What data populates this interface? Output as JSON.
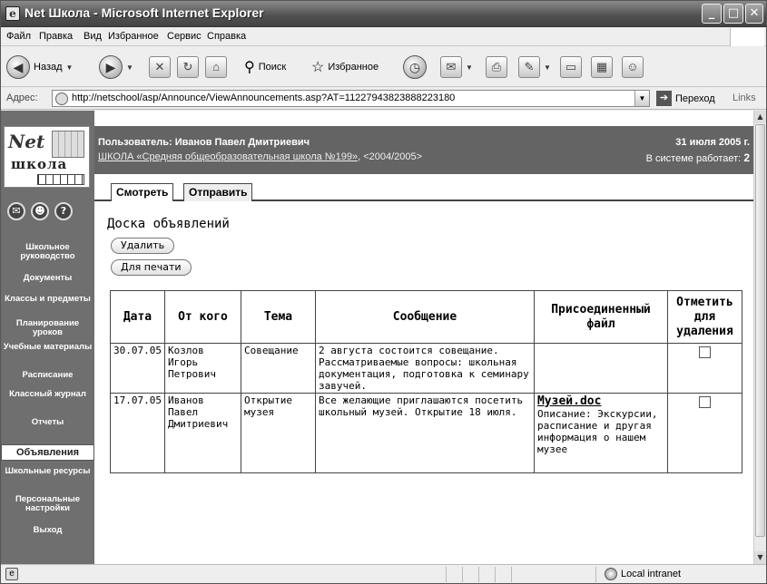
{
  "window": {
    "title": "Net Школа - Microsoft Internet Explorer"
  },
  "menu": [
    "Файл",
    "Правка",
    "Вид",
    "Избранное",
    "Сервис",
    "Справка"
  ],
  "toolbar": {
    "back": "Назад",
    "search": "Поиск",
    "favorites": "Избранное"
  },
  "address": {
    "label": "Адрес:",
    "url": "http://netschool/asp/Announce/ViewAnnouncements.asp?AT=11227943823888223180",
    "go": "Переход",
    "links": "Links"
  },
  "logo": {
    "net": "Net",
    "school": "школа"
  },
  "nav": [
    "Школьное руководство",
    "Документы",
    "Классы и предметы",
    "Планирование уроков",
    "Учебные материалы",
    "Расписание",
    "Классный журнал",
    "Отчеты",
    "Объявления",
    "Школьные ресурсы",
    "Персональные настройки",
    "Выход"
  ],
  "nav_active": "Объявления",
  "header": {
    "user": "Пользователь: Иванов Павел Дмитриевич",
    "school": "ШКОЛА «Средняя общеобразовательная школа №199»",
    "year": ", <2004/2005>",
    "date": "31 июля 2005 г.",
    "online_label": "В системе работает:",
    "online_count": "2"
  },
  "tabs": {
    "view": "Смотреть",
    "send": "Отправить"
  },
  "page": {
    "title": "Доска объявлений",
    "delete_btn": "Удалить",
    "print_btn": "Для печати"
  },
  "table": {
    "headers": [
      "Дата",
      "От кого",
      "Тема",
      "Сообщение",
      "Присоединенный файл",
      "Отметить для удаления"
    ],
    "rows": [
      {
        "date": "30.07.05",
        "from": "Козлов Игорь Петрович",
        "topic": "Совещание",
        "message": "2 августа состоится совещание. Рассматриваемые вопросы: школьная документация, подготовка к семинару завучей.",
        "file": "",
        "description": ""
      },
      {
        "date": "17.07.05",
        "from": "Иванов Павел Дмитриевич",
        "topic": "Открытие музея",
        "message": "Все желающие приглашаются посетить школьный музей. Открытие 18 июля.",
        "file": "Музей.doc",
        "description": "Описание: Экскурсии, расписание и другая информация о нашем музее"
      }
    ]
  },
  "status": {
    "zone": "Local intranet"
  }
}
